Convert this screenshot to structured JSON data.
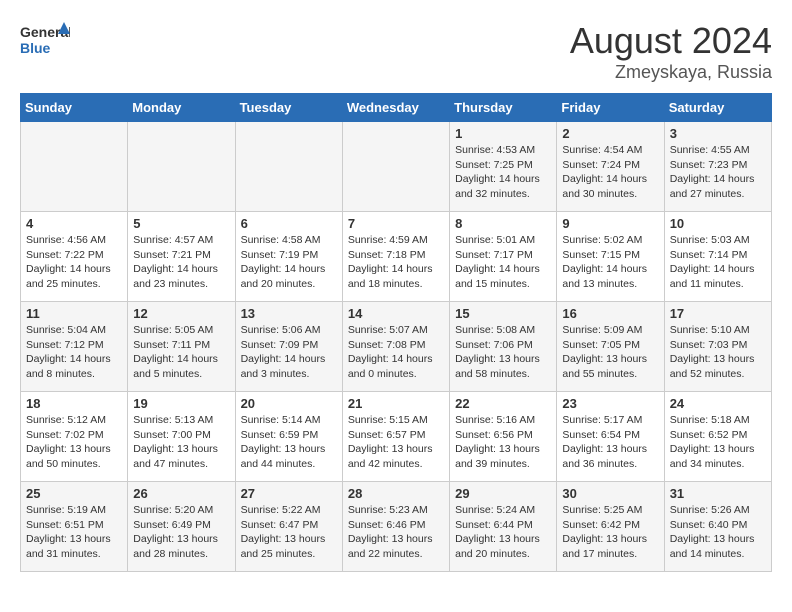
{
  "logo": {
    "line1": "General",
    "line2": "Blue"
  },
  "title": "August 2024",
  "location": "Zmeyskaya, Russia",
  "weekdays": [
    "Sunday",
    "Monday",
    "Tuesday",
    "Wednesday",
    "Thursday",
    "Friday",
    "Saturday"
  ],
  "weeks": [
    [
      {
        "day": "",
        "detail": ""
      },
      {
        "day": "",
        "detail": ""
      },
      {
        "day": "",
        "detail": ""
      },
      {
        "day": "",
        "detail": ""
      },
      {
        "day": "1",
        "detail": "Sunrise: 4:53 AM\nSunset: 7:25 PM\nDaylight: 14 hours\nand 32 minutes."
      },
      {
        "day": "2",
        "detail": "Sunrise: 4:54 AM\nSunset: 7:24 PM\nDaylight: 14 hours\nand 30 minutes."
      },
      {
        "day": "3",
        "detail": "Sunrise: 4:55 AM\nSunset: 7:23 PM\nDaylight: 14 hours\nand 27 minutes."
      }
    ],
    [
      {
        "day": "4",
        "detail": "Sunrise: 4:56 AM\nSunset: 7:22 PM\nDaylight: 14 hours\nand 25 minutes."
      },
      {
        "day": "5",
        "detail": "Sunrise: 4:57 AM\nSunset: 7:21 PM\nDaylight: 14 hours\nand 23 minutes."
      },
      {
        "day": "6",
        "detail": "Sunrise: 4:58 AM\nSunset: 7:19 PM\nDaylight: 14 hours\nand 20 minutes."
      },
      {
        "day": "7",
        "detail": "Sunrise: 4:59 AM\nSunset: 7:18 PM\nDaylight: 14 hours\nand 18 minutes."
      },
      {
        "day": "8",
        "detail": "Sunrise: 5:01 AM\nSunset: 7:17 PM\nDaylight: 14 hours\nand 15 minutes."
      },
      {
        "day": "9",
        "detail": "Sunrise: 5:02 AM\nSunset: 7:15 PM\nDaylight: 14 hours\nand 13 minutes."
      },
      {
        "day": "10",
        "detail": "Sunrise: 5:03 AM\nSunset: 7:14 PM\nDaylight: 14 hours\nand 11 minutes."
      }
    ],
    [
      {
        "day": "11",
        "detail": "Sunrise: 5:04 AM\nSunset: 7:12 PM\nDaylight: 14 hours\nand 8 minutes."
      },
      {
        "day": "12",
        "detail": "Sunrise: 5:05 AM\nSunset: 7:11 PM\nDaylight: 14 hours\nand 5 minutes."
      },
      {
        "day": "13",
        "detail": "Sunrise: 5:06 AM\nSunset: 7:09 PM\nDaylight: 14 hours\nand 3 minutes."
      },
      {
        "day": "14",
        "detail": "Sunrise: 5:07 AM\nSunset: 7:08 PM\nDaylight: 14 hours\nand 0 minutes."
      },
      {
        "day": "15",
        "detail": "Sunrise: 5:08 AM\nSunset: 7:06 PM\nDaylight: 13 hours\nand 58 minutes."
      },
      {
        "day": "16",
        "detail": "Sunrise: 5:09 AM\nSunset: 7:05 PM\nDaylight: 13 hours\nand 55 minutes."
      },
      {
        "day": "17",
        "detail": "Sunrise: 5:10 AM\nSunset: 7:03 PM\nDaylight: 13 hours\nand 52 minutes."
      }
    ],
    [
      {
        "day": "18",
        "detail": "Sunrise: 5:12 AM\nSunset: 7:02 PM\nDaylight: 13 hours\nand 50 minutes."
      },
      {
        "day": "19",
        "detail": "Sunrise: 5:13 AM\nSunset: 7:00 PM\nDaylight: 13 hours\nand 47 minutes."
      },
      {
        "day": "20",
        "detail": "Sunrise: 5:14 AM\nSunset: 6:59 PM\nDaylight: 13 hours\nand 44 minutes."
      },
      {
        "day": "21",
        "detail": "Sunrise: 5:15 AM\nSunset: 6:57 PM\nDaylight: 13 hours\nand 42 minutes."
      },
      {
        "day": "22",
        "detail": "Sunrise: 5:16 AM\nSunset: 6:56 PM\nDaylight: 13 hours\nand 39 minutes."
      },
      {
        "day": "23",
        "detail": "Sunrise: 5:17 AM\nSunset: 6:54 PM\nDaylight: 13 hours\nand 36 minutes."
      },
      {
        "day": "24",
        "detail": "Sunrise: 5:18 AM\nSunset: 6:52 PM\nDaylight: 13 hours\nand 34 minutes."
      }
    ],
    [
      {
        "day": "25",
        "detail": "Sunrise: 5:19 AM\nSunset: 6:51 PM\nDaylight: 13 hours\nand 31 minutes."
      },
      {
        "day": "26",
        "detail": "Sunrise: 5:20 AM\nSunset: 6:49 PM\nDaylight: 13 hours\nand 28 minutes."
      },
      {
        "day": "27",
        "detail": "Sunrise: 5:22 AM\nSunset: 6:47 PM\nDaylight: 13 hours\nand 25 minutes."
      },
      {
        "day": "28",
        "detail": "Sunrise: 5:23 AM\nSunset: 6:46 PM\nDaylight: 13 hours\nand 22 minutes."
      },
      {
        "day": "29",
        "detail": "Sunrise: 5:24 AM\nSunset: 6:44 PM\nDaylight: 13 hours\nand 20 minutes."
      },
      {
        "day": "30",
        "detail": "Sunrise: 5:25 AM\nSunset: 6:42 PM\nDaylight: 13 hours\nand 17 minutes."
      },
      {
        "day": "31",
        "detail": "Sunrise: 5:26 AM\nSunset: 6:40 PM\nDaylight: 13 hours\nand 14 minutes."
      }
    ]
  ]
}
